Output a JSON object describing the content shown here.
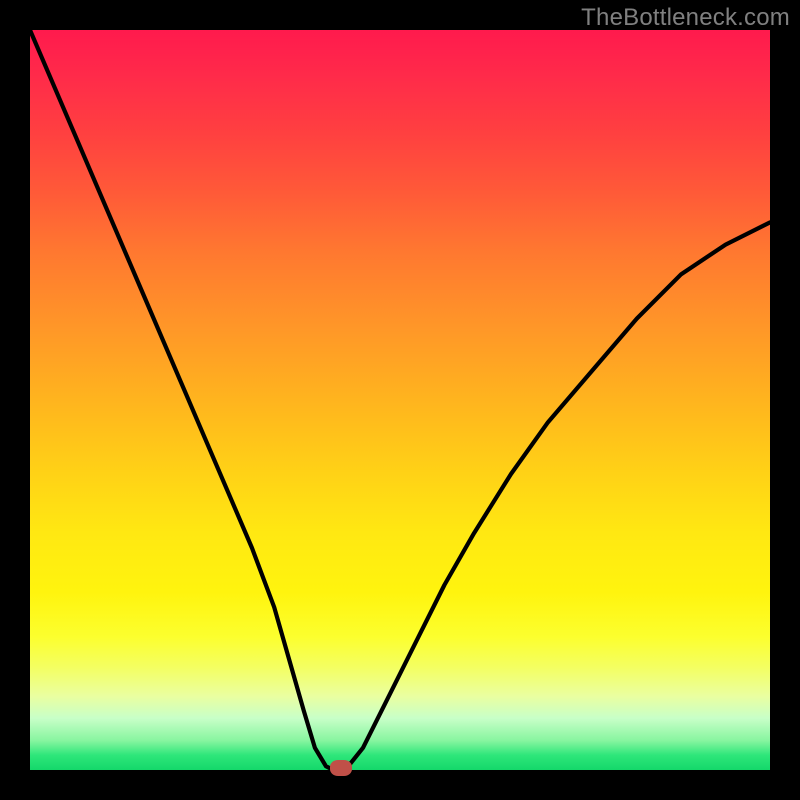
{
  "watermark": "TheBottleneck.com",
  "colors": {
    "frame": "#000000",
    "gradient_top": "#ff1a4d",
    "gradient_bottom": "#14d86a",
    "curve": "#000000",
    "marker": "#c05048",
    "watermark_text": "#808080"
  },
  "chart_data": {
    "type": "line",
    "title": "",
    "xlabel": "",
    "ylabel": "",
    "xlim": [
      0,
      100
    ],
    "ylim": [
      0,
      100
    ],
    "series": [
      {
        "name": "bottleneck-curve",
        "x": [
          0,
          3,
          6,
          9,
          12,
          15,
          18,
          21,
          24,
          27,
          30,
          33,
          35,
          37,
          38.5,
          40,
          41,
          42,
          43,
          45,
          48,
          52,
          56,
          60,
          65,
          70,
          76,
          82,
          88,
          94,
          100
        ],
        "y": [
          100,
          93,
          86,
          79,
          72,
          65,
          58,
          51,
          44,
          37,
          30,
          22,
          15,
          8,
          3,
          0.5,
          0,
          0,
          0.5,
          3,
          9,
          17,
          25,
          32,
          40,
          47,
          54,
          61,
          67,
          71,
          74
        ]
      }
    ],
    "marker": {
      "x": 42,
      "y": 0
    },
    "grid": false,
    "legend": false
  }
}
